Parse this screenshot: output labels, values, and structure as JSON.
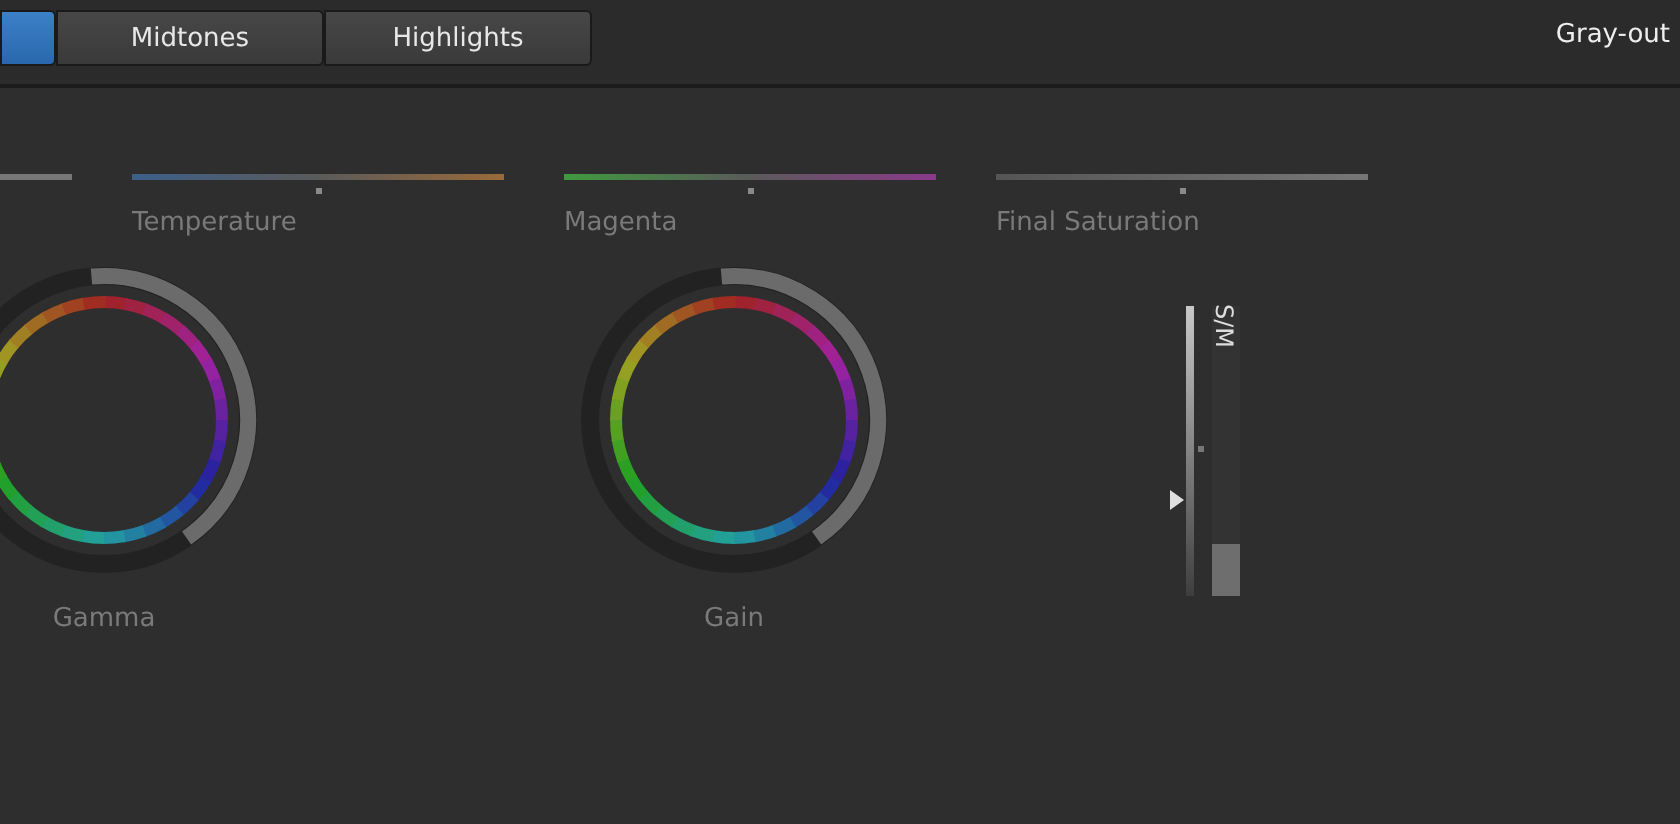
{
  "tabs": [
    {
      "selected": true
    },
    {
      "label": "Midtones",
      "selected": false
    },
    {
      "label": "Highlights",
      "selected": false
    }
  ],
  "mode_label": "Gray-out",
  "sliders": [
    {
      "kind": "plain"
    },
    {
      "kind": "temperature",
      "label": "Temperature",
      "level": 0.5
    },
    {
      "kind": "tint",
      "label": "Magenta",
      "level": 0.5
    },
    {
      "kind": "saturation",
      "label": "Final Saturation",
      "level": 0.5
    }
  ],
  "wheels": [
    {
      "label": "Gamma"
    },
    {
      "label": "Gain"
    }
  ],
  "meter": {
    "label": "S/M",
    "marker": {
      "level": 0.33
    },
    "bar": {
      "level": 0.18
    }
  }
}
